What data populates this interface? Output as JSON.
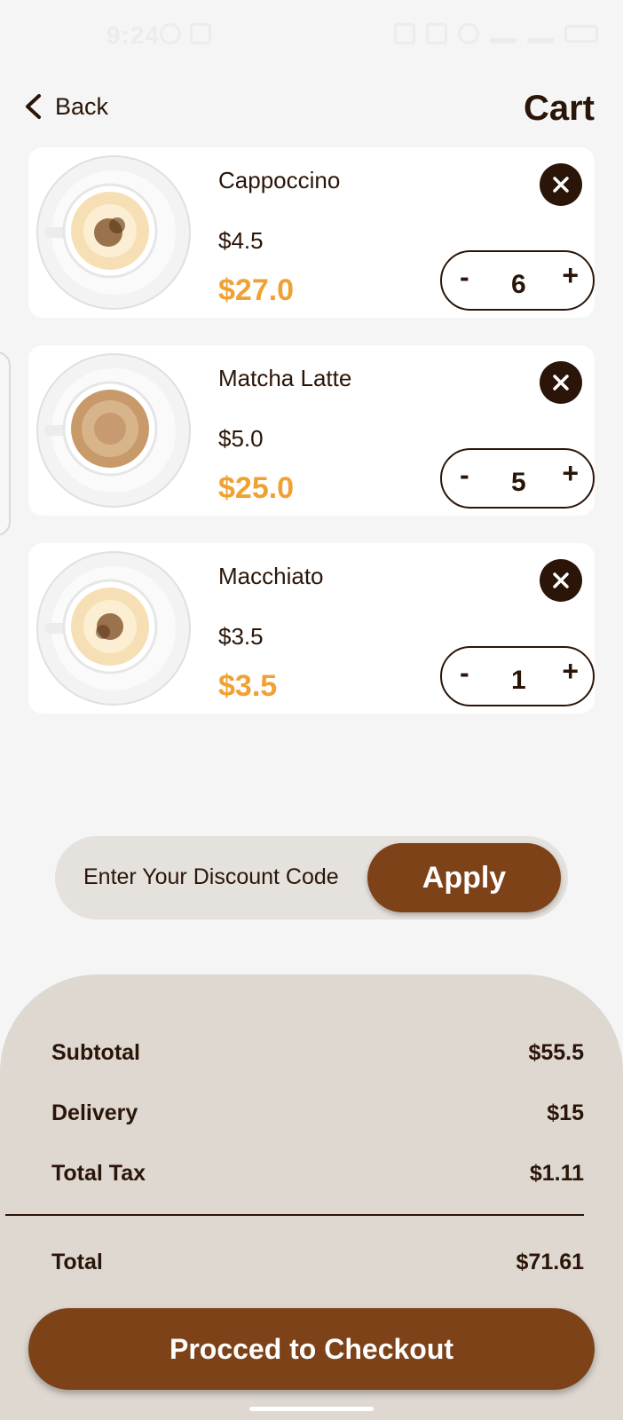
{
  "status_bar": {
    "time": "9:24"
  },
  "header": {
    "back_label": "Back",
    "title": "Cart"
  },
  "cart_items": [
    {
      "name": "Cappoccino",
      "unit_price": "$4.5",
      "line_total": "$27.0",
      "quantity": "6",
      "minus": "-",
      "plus": "+"
    },
    {
      "name": "Matcha Latte",
      "unit_price": "$5.0",
      "line_total": "$25.0",
      "quantity": "5",
      "minus": "-",
      "plus": "+"
    },
    {
      "name": "Macchiato",
      "unit_price": "$3.5",
      "line_total": "$3.5",
      "quantity": "1",
      "minus": "-",
      "plus": "+"
    }
  ],
  "discount": {
    "placeholder": "Enter Your Discount Code",
    "apply_label": "Apply"
  },
  "summary": {
    "subtotal_label": "Subtotal",
    "subtotal_value": "$55.5",
    "delivery_label": "Delivery",
    "delivery_value": "$15",
    "tax_label": "Total Tax",
    "tax_value": "$1.11",
    "total_label": "Total",
    "total_value": "$71.61"
  },
  "checkout": {
    "label": "Procced to Checkout"
  },
  "colors": {
    "accent": "#7e4219",
    "price": "#f0a133",
    "text": "#2a1508",
    "sheet": "#ded8d1"
  }
}
